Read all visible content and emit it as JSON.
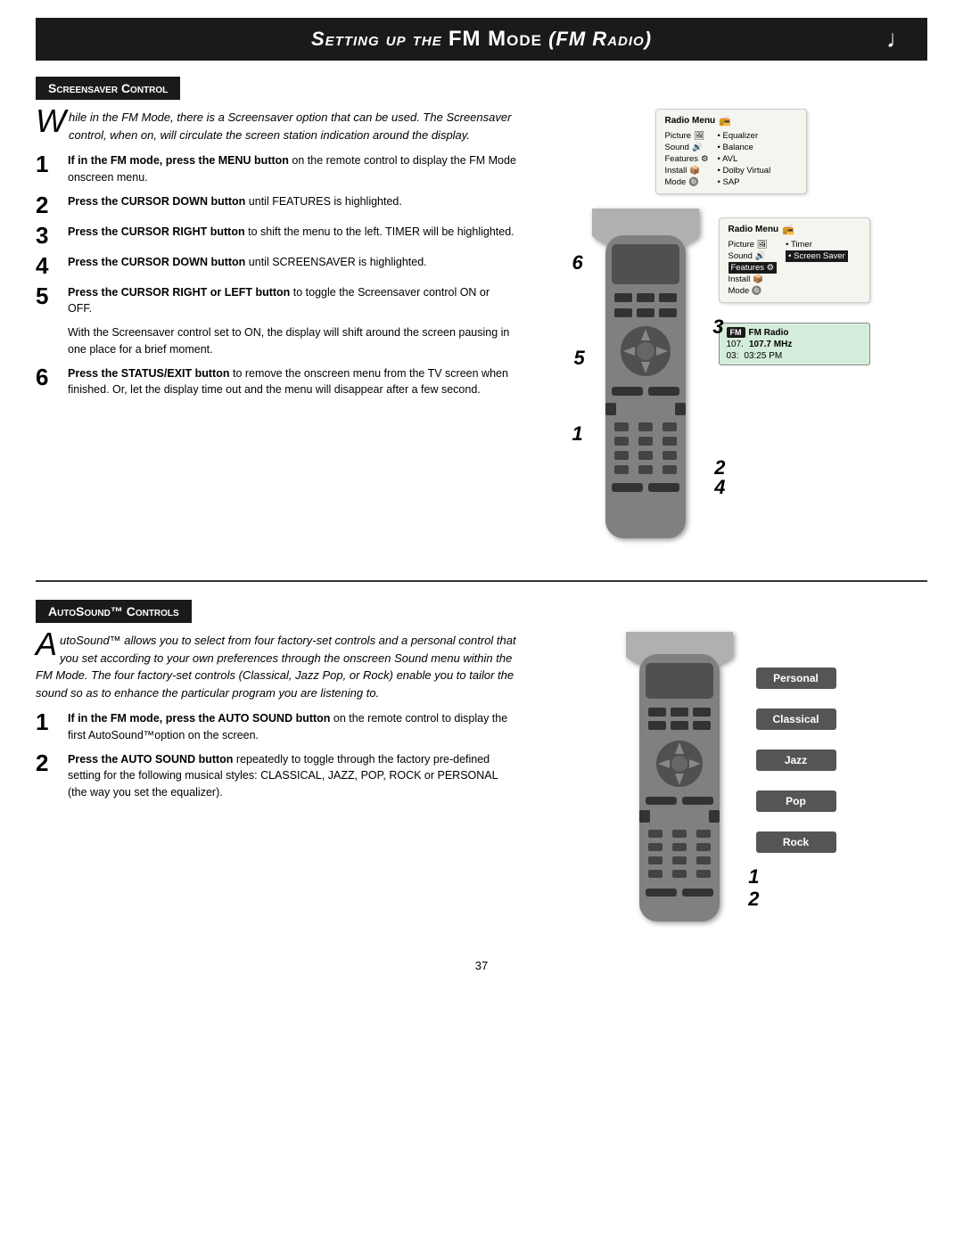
{
  "header": {
    "title_prefix": "Setting up the ",
    "title_bold": "FM Mode",
    "title_suffix": " (FM Radio)",
    "music_icon": "♩"
  },
  "screensaver_section": {
    "header": "Screensaver Control",
    "intro": {
      "drop_cap": "W",
      "text": "hile in the FM Mode, there is a Screensaver option that can be used. The Screensaver control, when on, will circulate the screen station indication around the display."
    },
    "steps": [
      {
        "num": "1",
        "bold": "If in the FM mode, press the MENU button",
        "normal": " on the remote control to display the FM Mode onscreen menu."
      },
      {
        "num": "2",
        "bold": "Press the CURSOR DOWN button",
        "normal": " until FEATURES is highlighted."
      },
      {
        "num": "3",
        "bold": "Press the CURSOR RIGHT button",
        "normal": " to shift the menu to the left. TIMER will be highlighted."
      },
      {
        "num": "4",
        "bold": "Press the CURSOR DOWN button",
        "normal": " until SCREENSAVER is highlighted."
      },
      {
        "num": "5",
        "bold": "Press the CURSOR RIGHT or LEFT button",
        "normal": " to toggle the Screensaver control ON or OFF."
      },
      {
        "num": "extra",
        "bold": "",
        "normal": "With the Screensaver control set to ON, the display will shift around the screen pausing in one place for a brief moment."
      },
      {
        "num": "6",
        "bold": "Press the STATUS/EXIT button",
        "normal": " to remove the onscreen menu from the TV screen when finished. Or, let the display time out and the menu will disappear after a few second."
      }
    ],
    "menu1": {
      "title": "Radio Menu",
      "rows_left": [
        "Picture",
        "Sound",
        "Features",
        "Install",
        "Mode"
      ],
      "rows_right": [
        "Equalizer",
        "Balance",
        "AVL",
        "Dolby Virtual",
        "SAP"
      ]
    },
    "menu2": {
      "title": "Radio Menu",
      "rows_left": [
        "Picture",
        "Sound",
        "Features",
        "Install",
        "Mode"
      ],
      "rows_right": [
        "Timer",
        "Screen Saver"
      ],
      "highlighted": "Features"
    },
    "fm_display": {
      "band": "FM",
      "label": "FM Radio",
      "freq1": "107.",
      "freq2": "107.7 MHz",
      "time1": "03:",
      "time2": "03:25 PM"
    },
    "step_numbers_on_remote": [
      "6",
      "3",
      "5",
      "1",
      "2",
      "4"
    ]
  },
  "autosound_section": {
    "header": "AutoSound™ Controls",
    "intro": {
      "drop_cap": "A",
      "text": "utoSound™ allows you to select from four factory-set controls and a personal control that you set according to your own preferences through the onscreen Sound menu within the FM Mode. The four factory-set controls (Classical, Jazz Pop, or Rock) enable you to tailor the sound so as to enhance the particular program you are listening to."
    },
    "steps": [
      {
        "num": "1",
        "bold": "If in the FM mode, press the AUTO SOUND button",
        "normal": " on the remote control to display the first AutoSound™option on the screen."
      },
      {
        "num": "2",
        "bold": "Press the AUTO SOUND button",
        "normal": " repeatedly to toggle through the factory pre-defined setting for the following musical styles: CLASSICAL, JAZZ, POP, ROCK or PERSONAL (the way you set the equalizer)."
      }
    ],
    "sound_options": [
      {
        "label": "Personal",
        "class": "personal"
      },
      {
        "label": "Classical",
        "class": "classical"
      },
      {
        "label": "Jazz",
        "class": "jazz"
      },
      {
        "label": "Pop",
        "class": "pop"
      },
      {
        "label": "Rock",
        "class": "rock"
      }
    ],
    "step_numbers_on_remote": [
      "1",
      "2"
    ]
  },
  "page_number": "37"
}
